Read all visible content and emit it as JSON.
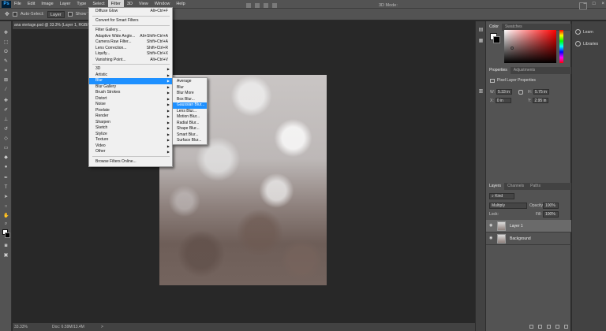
{
  "menubar": {
    "logo": "Ps",
    "items": [
      "File",
      "Edit",
      "Image",
      "Layer",
      "Type",
      "Select",
      "Filter",
      "3D",
      "View",
      "Window",
      "Help"
    ],
    "active": "Filter"
  },
  "window_controls": [
    "–",
    "□",
    "×"
  ],
  "options_bar": {
    "auto_select_label": "Auto-Select:",
    "auto_select_value": "Layer",
    "show_transform_label": "Show Tra",
    "mode_label": "3D Mode:"
  },
  "document": {
    "tab_title": "ana viertage.psd @ 33.3% (Layer 1, RGB/8#)",
    "close": "×"
  },
  "status": {
    "zoom": "33.33%",
    "doc_info": "Doc: 6.59M/13.4M",
    "arrow": ">"
  },
  "filter_menu": {
    "items": [
      {
        "label": "Diffuse Glow",
        "shortcut": "Alt+Ctrl+F"
      },
      {
        "label": "Convert for Smart Filters",
        "shortcut": ""
      },
      {
        "label": "Filter Gallery...",
        "shortcut": ""
      },
      {
        "label": "Adaptive Wide Angle...",
        "shortcut": "Alt+Shift+Ctrl+A"
      },
      {
        "label": "Camera Raw Filter...",
        "shortcut": "Shift+Ctrl+A"
      },
      {
        "label": "Lens Correction...",
        "shortcut": "Shift+Ctrl+R"
      },
      {
        "label": "Liquify...",
        "shortcut": "Shift+Ctrl+X"
      },
      {
        "label": "Vanishing Point...",
        "shortcut": "Alt+Ctrl+V"
      },
      {
        "label": "3D",
        "shortcut": ""
      },
      {
        "label": "Artistic",
        "shortcut": ""
      },
      {
        "label": "Blur",
        "shortcut": ""
      },
      {
        "label": "Blur Gallery",
        "shortcut": ""
      },
      {
        "label": "Brush Strokes",
        "shortcut": ""
      },
      {
        "label": "Distort",
        "shortcut": ""
      },
      {
        "label": "Noise",
        "shortcut": ""
      },
      {
        "label": "Pixelate",
        "shortcut": ""
      },
      {
        "label": "Render",
        "shortcut": ""
      },
      {
        "label": "Sharpen",
        "shortcut": ""
      },
      {
        "label": "Sketch",
        "shortcut": ""
      },
      {
        "label": "Stylize",
        "shortcut": ""
      },
      {
        "label": "Texture",
        "shortcut": ""
      },
      {
        "label": "Video",
        "shortcut": ""
      },
      {
        "label": "Other",
        "shortcut": ""
      },
      {
        "label": "Browse Filters Online...",
        "shortcut": ""
      }
    ],
    "highlighted": "Blur",
    "submenu_arrow": "▶"
  },
  "blur_menu": {
    "items": [
      "Average",
      "Blur",
      "Blur More",
      "Box Blur...",
      "Gaussian Blur...",
      "Lens Blur...",
      "Motion Blur...",
      "Radial Blur...",
      "Shape Blur...",
      "Smart Blur...",
      "Surface Blur..."
    ],
    "highlighted": "Gaussian Blur..."
  },
  "panels": {
    "color_tabs": [
      "Color",
      "Swatches"
    ],
    "properties_tabs": [
      "Properties",
      "Adjustments"
    ],
    "properties_title": "Pixel Layer Properties",
    "w_label": "W:",
    "w_value": "5.33 in",
    "h_label": "H:",
    "h_value": "5.75 in",
    "x_label": "X:",
    "x_value": "0 in",
    "y_label": "Y:",
    "y_value": "2.95 in",
    "layers_tabs": [
      "Layers",
      "Channels",
      "Paths"
    ],
    "kind_label": "Kind",
    "blend_mode": "Multiply",
    "opacity_label": "Opacity:",
    "opacity_value": "100%",
    "lock_label": "Lock:",
    "fill_label": "Fill:",
    "fill_value": "100%",
    "layers": [
      {
        "name": "Layer 1",
        "selected": true
      },
      {
        "name": "Background",
        "selected": false
      }
    ]
  },
  "right_column": {
    "learn": "Learn",
    "libraries": "Libraries"
  },
  "colors": {
    "highlight": "#1e90ff",
    "panel_bg": "#535353",
    "workspace_bg": "#282828"
  }
}
